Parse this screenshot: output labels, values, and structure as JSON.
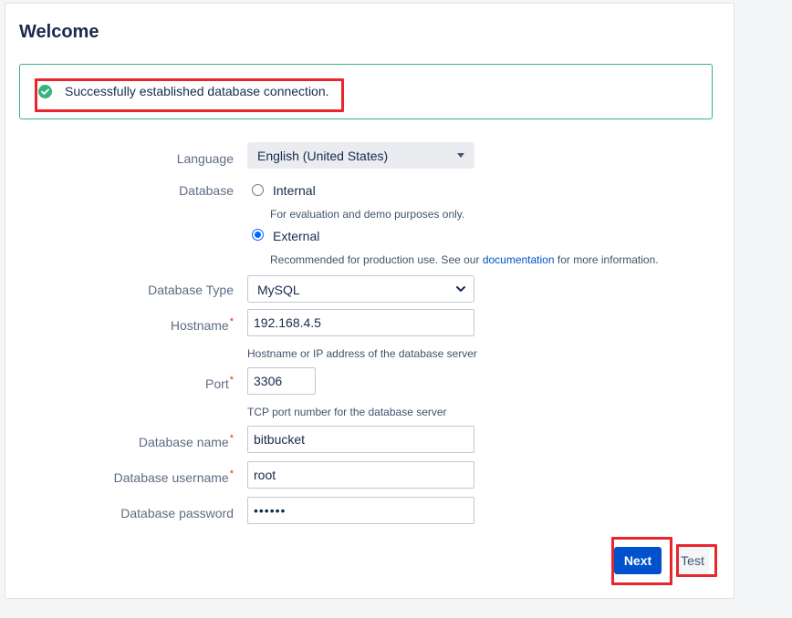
{
  "header": {
    "title": "Welcome"
  },
  "alert": {
    "message": "Successfully established database connection."
  },
  "form": {
    "language": {
      "label": "Language",
      "value": "English (United States)"
    },
    "database": {
      "label": "Database",
      "internal_label": "Internal",
      "internal_hint": "For evaluation and demo purposes only.",
      "external_label": "External",
      "external_hint_before": "Recommended for production use. See our ",
      "external_hint_link": "documentation",
      "external_hint_after": " for more information.",
      "selected": "External"
    },
    "db_type": {
      "label": "Database Type",
      "value": "MySQL"
    },
    "hostname": {
      "label": "Hostname",
      "value": "192.168.4.5",
      "hint": "Hostname or IP address of the database server"
    },
    "port": {
      "label": "Port",
      "value": "3306",
      "hint": "TCP port number for the database server"
    },
    "db_name": {
      "label": "Database name",
      "value": "bitbucket"
    },
    "db_username": {
      "label": "Database username",
      "value": "root"
    },
    "db_password": {
      "label": "Database password",
      "value": "••••••"
    },
    "required_marker": "*"
  },
  "actions": {
    "next_label": "Next",
    "test_label": "Test"
  },
  "colors": {
    "primary": "#0052cc",
    "success": "#36b37e",
    "highlight": "#e8262c"
  }
}
